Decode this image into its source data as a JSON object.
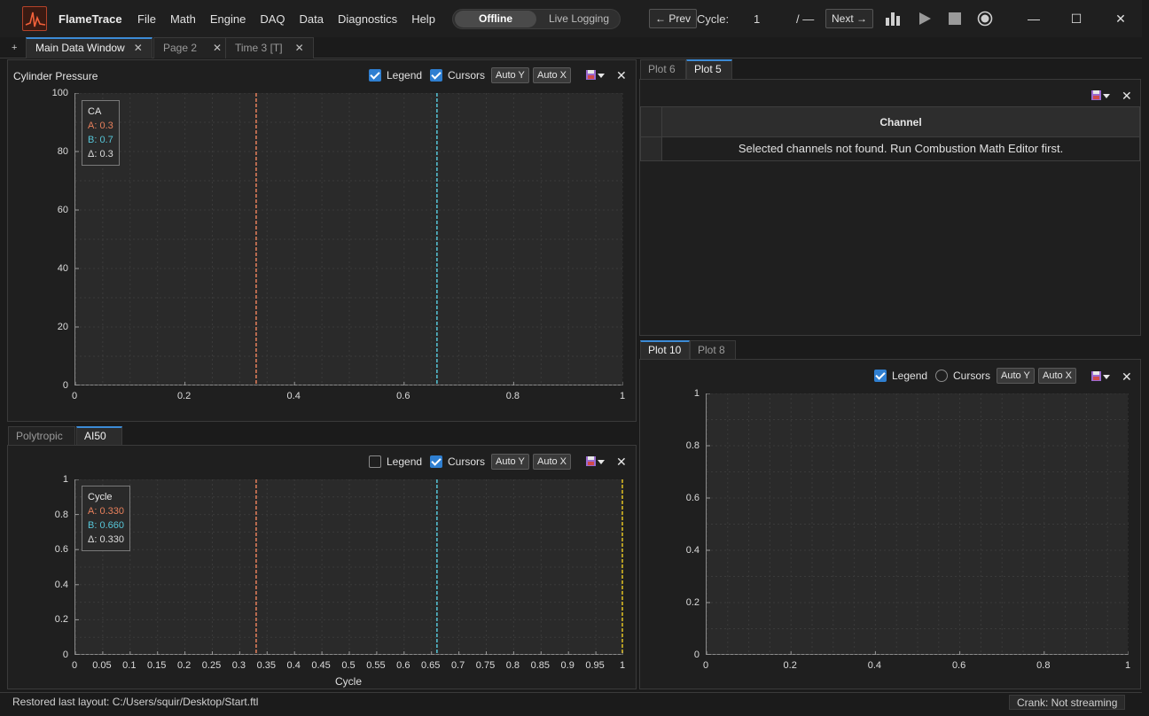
{
  "app": {
    "name": "FlameTrace"
  },
  "menu": [
    "Math",
    "Engine",
    "DAQ",
    "Data",
    "Diagnostics",
    "Help"
  ],
  "menu_file": "File",
  "mode": {
    "active": "Offline",
    "inactive": "Live Logging"
  },
  "nav": {
    "prev": "← Prev",
    "cycle_label": "Cycle:",
    "cycle_value": "1",
    "cycle_total": "/ —",
    "next": "Next →"
  },
  "tabs": [
    {
      "label": "Main Data Window",
      "active": true
    },
    {
      "label": "Page 2",
      "active": false
    },
    {
      "label": "Time 3 [T]",
      "active": false
    }
  ],
  "tab_plus": "+",
  "pressure": {
    "title": "Cylinder Pressure",
    "legend_label": "Legend",
    "cursors_label": "Cursors",
    "auto_y": "Auto Y",
    "auto_x": "Auto X",
    "legend_title": "CA",
    "cursor_a": "A: 0.3",
    "cursor_b": "B: 0.7",
    "cursor_d": "Δ: 0.3"
  },
  "lower_tabs": [
    {
      "label": "Polytropic",
      "active": false
    },
    {
      "label": "AI50",
      "active": true
    }
  ],
  "ai50": {
    "legend_label": "Legend",
    "cursors_label": "Cursors",
    "auto_y": "Auto Y",
    "auto_x": "Auto X",
    "xlabel": "Cycle",
    "legend_title": "Cycle",
    "cursor_a": "A: 0.330",
    "cursor_b": "B: 0.660",
    "cursor_d": "Δ: 0.330"
  },
  "right_top_tabs": [
    {
      "label": "Plot 6",
      "active": false
    },
    {
      "label": "Plot 5",
      "active": true
    }
  ],
  "table": {
    "header": "Channel",
    "message": "Selected channels not found.  Run Combustion Math Editor first."
  },
  "right_bottom_tabs": [
    {
      "label": "Plot 10",
      "active": true
    },
    {
      "label": "Plot 8",
      "active": false
    }
  ],
  "plot10": {
    "legend_label": "Legend",
    "cursors_label": "Cursors",
    "auto_y": "Auto Y",
    "auto_x": "Auto X"
  },
  "status": {
    "left": "Restored last layout: C:/Users/squir/Desktop/Start.ftl",
    "right": "Crank: Not streaming"
  },
  "colors": {
    "cursor_a": "#e8805c",
    "cursor_b": "#57c6d8",
    "extra_cursor": "#e0c020",
    "accent": "#2f7fd1"
  },
  "chart_data": [
    {
      "type": "line",
      "title": "Cylinder Pressure",
      "xlabel": "",
      "ylabel": "",
      "xlim": [
        0,
        1
      ],
      "ylim": [
        0,
        100
      ],
      "x_ticks": [
        "0",
        "0.2",
        "0.4",
        "0.6",
        "0.8",
        "1"
      ],
      "y_ticks": [
        "0",
        "20",
        "40",
        "60",
        "80",
        "100"
      ],
      "cursors": [
        0.33,
        0.66
      ],
      "series": []
    },
    {
      "type": "line",
      "title": "",
      "xlabel": "Cycle",
      "ylabel": "",
      "xlim": [
        0,
        1
      ],
      "ylim": [
        0,
        1
      ],
      "x_ticks": [
        "0",
        "0.05",
        "0.1",
        "0.15",
        "0.2",
        "0.25",
        "0.3",
        "0.35",
        "0.4",
        "0.45",
        "0.5",
        "0.55",
        "0.6",
        "0.65",
        "0.7",
        "0.75",
        "0.8",
        "0.85",
        "0.9",
        "0.95",
        "1"
      ],
      "y_ticks": [
        "0",
        "0.2",
        "0.4",
        "0.6",
        "0.8",
        "1"
      ],
      "cursors": [
        0.33,
        0.66,
        1.0
      ],
      "series": []
    },
    {
      "type": "line",
      "title": "",
      "xlabel": "",
      "ylabel": "",
      "xlim": [
        0,
        1
      ],
      "ylim": [
        0,
        1
      ],
      "x_ticks": [
        "0",
        "0.2",
        "0.4",
        "0.6",
        "0.8",
        "1"
      ],
      "y_ticks": [
        "0",
        "0.2",
        "0.4",
        "0.6",
        "0.8",
        "1"
      ],
      "cursors": [],
      "series": []
    }
  ]
}
